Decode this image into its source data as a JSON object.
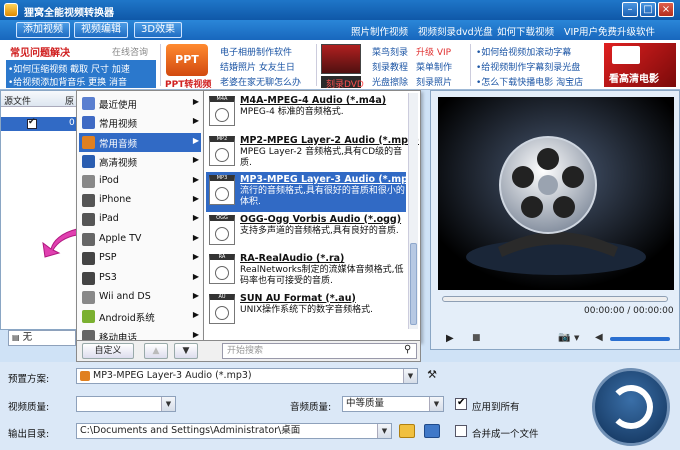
{
  "window": {
    "title": "狸窝全能视频转换器"
  },
  "toolbar": {
    "add_video": "添加视频",
    "edit_video": "视频编辑",
    "effect_3d": "3D效果",
    "links": [
      "照片制作视频",
      "视频刻录dvd光盘",
      "如何下载视频",
      "VIP用户免费升级软件"
    ]
  },
  "ads": {
    "col1": {
      "heading": "常见问题解决",
      "online": "在线咨询",
      "line1": "•如何压缩视频 截取 尺寸 加速",
      "line2": "•给视频添加背音乐 更换 消音"
    },
    "ppt_label": "PPT转视频",
    "col2": [
      "电子相册制作软件",
      "结婚照片 女友生日",
      "老婆在家无聊怎么办"
    ],
    "dvd_label": "刻录DVD",
    "col3": {
      "r1a": "菜鸟刻录",
      "r1b": "升级 VIP",
      "r2a": "刻录教程",
      "r2b": "菜单制作",
      "r3a": "光盘擦除",
      "r3b": "刻录照片"
    },
    "col4": [
      "•如何给视频加滚动字幕",
      "•给视频制作字幕刻录光盘",
      "•怎么下载快播电影 淘宝店"
    ],
    "banner": "看高清电影"
  },
  "left_panel": {
    "header": "源文件",
    "header2": "原",
    "row_value": "0"
  },
  "subtitle_combo": "无",
  "menu_categories": [
    {
      "label": "最近使用",
      "icon": "clock-icon"
    },
    {
      "label": "常用视频",
      "icon": "video-icon"
    },
    {
      "label": "常用音频",
      "icon": "music-icon"
    },
    {
      "label": "高清视频",
      "icon": "hd-icon"
    },
    {
      "label": "iPod",
      "icon": "ipod-icon"
    },
    {
      "label": "iPhone",
      "icon": "iphone-icon"
    },
    {
      "label": "iPad",
      "icon": "ipad-icon"
    },
    {
      "label": "Apple TV",
      "icon": "appletv-icon"
    },
    {
      "label": "PSP",
      "icon": "psp-icon"
    },
    {
      "label": "PS3",
      "icon": "ps3-icon"
    },
    {
      "label": "Wii and DS",
      "icon": "wii-icon"
    },
    {
      "label": "Android系统",
      "icon": "android-icon"
    },
    {
      "label": "移动电话",
      "icon": "phone-icon"
    }
  ],
  "formats": [
    {
      "tag": "M4A",
      "title": "M4A-MPEG-4 Audio (*.m4a)",
      "desc": "MPEG-4 标准的音频格式."
    },
    {
      "tag": "MP2",
      "title": "MP2-MPEG Layer-2 Audio (*.mp2)",
      "desc": "MPEG Layer-2 音频格式,具有CD级的音质."
    },
    {
      "tag": "MP3",
      "title": "MP3-MPEG Layer-3 Audio (*.mp3)",
      "desc": "流行的音频格式,具有很好的音质和很小的体积."
    },
    {
      "tag": "OGG",
      "title": "OGG-Ogg Vorbis Audio (*.ogg)",
      "desc": "支持多声道的音频格式,具有良好的音质."
    },
    {
      "tag": "RA",
      "title": "RA-RealAudio (*.ra)",
      "desc": "RealNetworks制定的流媒体音频格式,低码率也有可接受的音质."
    },
    {
      "tag": "AU",
      "title": "SUN AU Format (*.au)",
      "desc": "UNIX操作系统下的数字音频格式."
    }
  ],
  "menu_footer": {
    "custom": "自定义",
    "search_placeholder": "开始搜索"
  },
  "player": {
    "time": "00:00:00 / 00:00:00"
  },
  "settings": {
    "preset_label": "预置方案:",
    "preset_value": "MP3-MPEG Layer-3 Audio (*.mp3)",
    "video_quality_label": "视频质量:",
    "video_quality_value": "",
    "audio_quality_label": "音频质量:",
    "audio_quality_value": "中等质量",
    "apply_all": "应用到所有",
    "output_label": "输出目录:",
    "output_value": "C:\\Documents and Settings\\Administrator\\桌面",
    "merge": "合并成一个文件"
  },
  "colors": {
    "accent": "#316ac5",
    "title_bar": "#1f76c8"
  }
}
